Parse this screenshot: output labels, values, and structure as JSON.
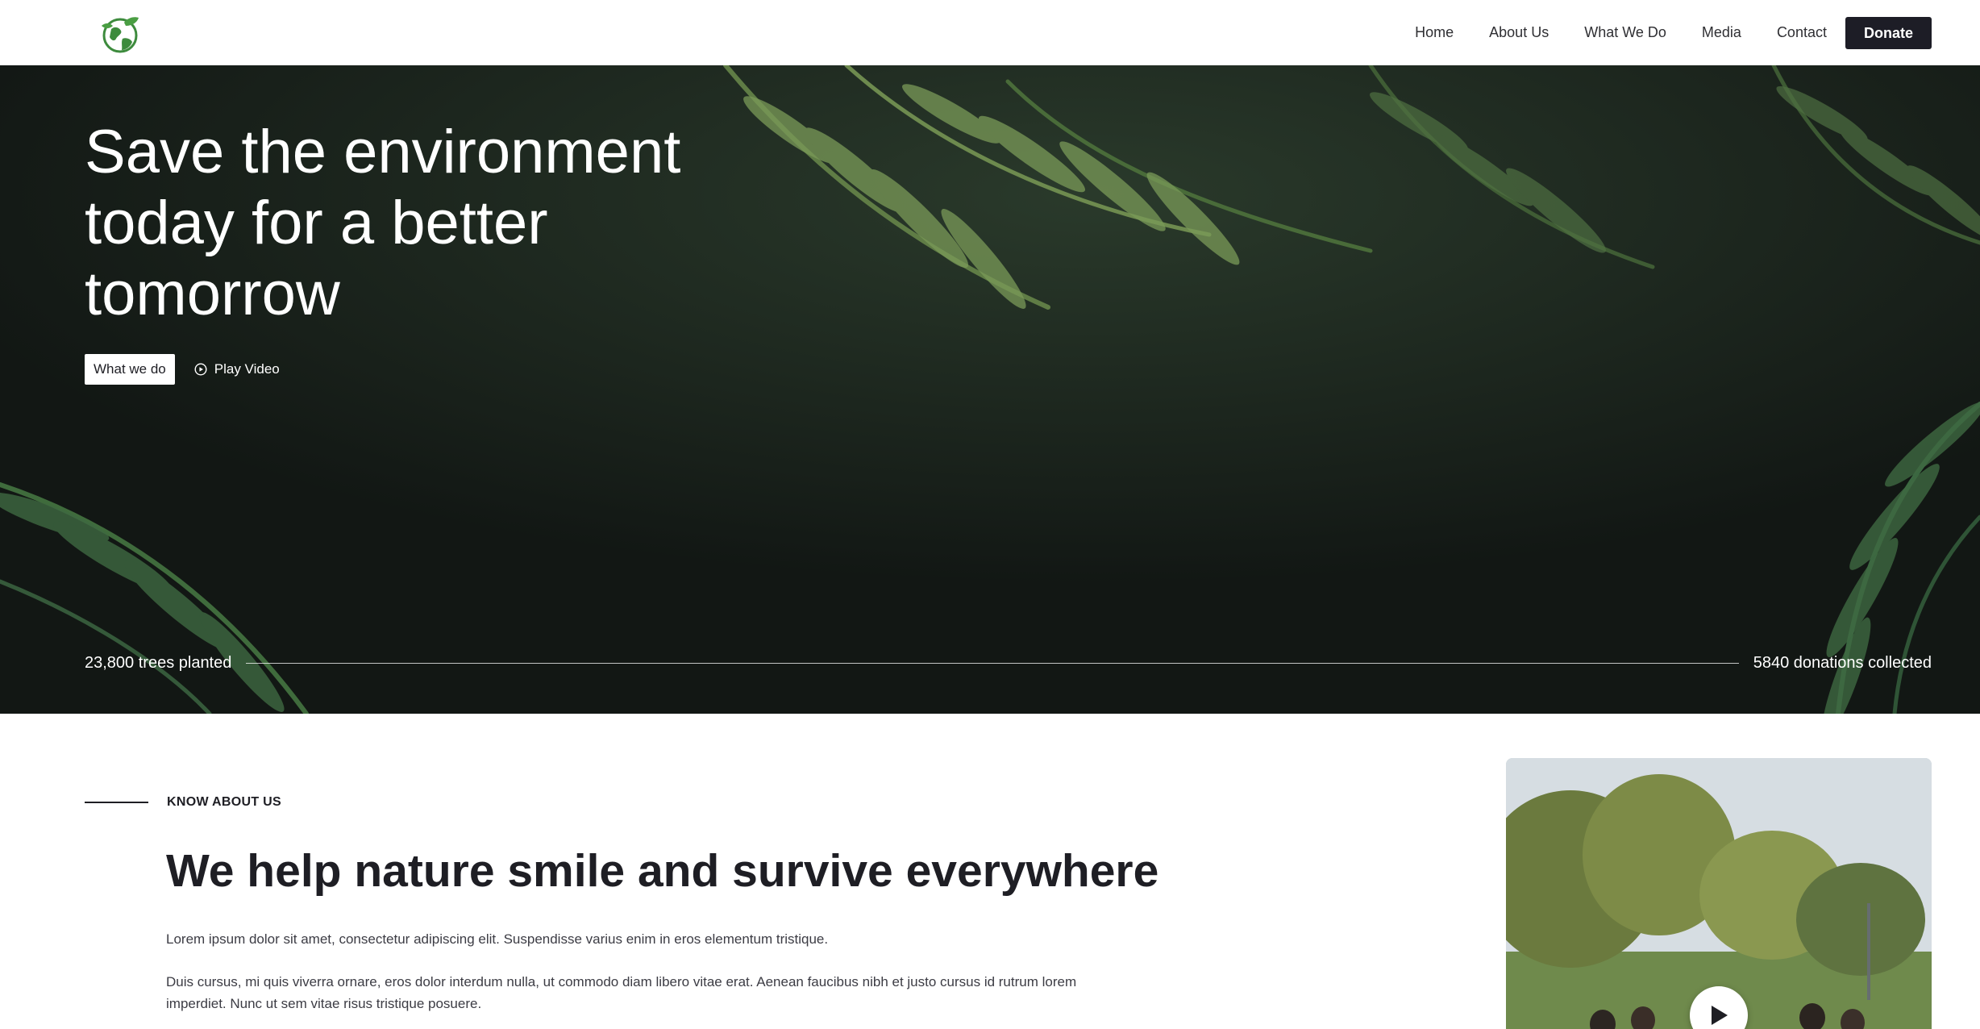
{
  "nav": {
    "logo_icon": "globe-leaf-icon",
    "links": [
      "Home",
      "About Us",
      "What We Do",
      "Media",
      "Contact"
    ],
    "donate_label": "Donate"
  },
  "hero": {
    "title": "Save the environment today for a better tomorrow",
    "primary_button": "What we do",
    "secondary_button": "Play Video",
    "secondary_icon": "play-circle-icon",
    "stats": {
      "left": "23,800 trees planted",
      "right": "5840 donations collected"
    }
  },
  "about": {
    "eyebrow": "KNOW ABOUT US",
    "heading": "We help nature smile and survive everywhere",
    "paragraphs": [
      "Lorem ipsum dolor sit amet, consectetur adipiscing elit. Suspendisse varius enim in eros elementum tristique.",
      "Duis cursus, mi quis viverra ornare, eros dolor interdum nulla, ut commodo diam libero vitae erat. Aenean faucibus nibh et justo cursus id rutrum lorem imperdiet. Nunc ut sem vitae risus tristique posuere."
    ],
    "video_icon": "play-icon"
  },
  "colors": {
    "brand_dark": "#1d1d26",
    "brand_green": "#3d8b3d",
    "hero_bg": "#151a17"
  }
}
